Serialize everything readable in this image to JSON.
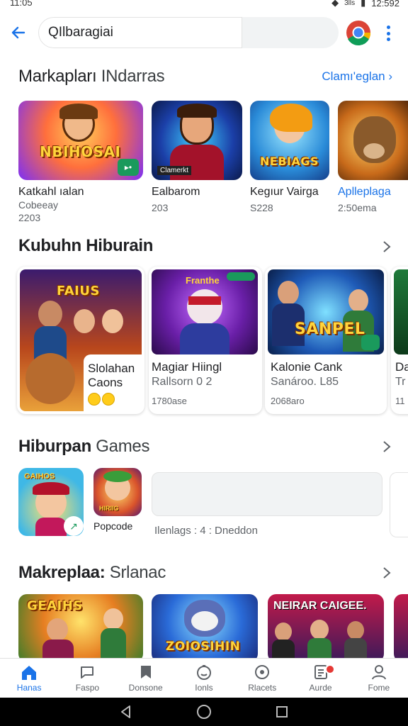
{
  "status": {
    "time": "11:05",
    "right_text": "12:592",
    "sim": "3lls"
  },
  "search": {
    "value": "Q​Ilbaragiai",
    "placeholder": ""
  },
  "sections": {
    "s1": {
      "title_bold": "Markapları",
      "title_rest": " INdarras",
      "link": "Clamı'eglan"
    },
    "s2": {
      "title_bold": "Kubuhn Hiburain"
    },
    "s3": {
      "title_bold": "Hiburpan",
      "title_rest": " Games"
    },
    "s4": {
      "title_bold": "Makreplaa:",
      "title_rest": " Srlanac"
    }
  },
  "row1": [
    {
      "art_text": "NBIHOSAI",
      "name": "Katkahl ıalan",
      "meta1": "Cobeeay",
      "meta2": "2203"
    },
    {
      "art_text": "Clamerkt",
      "name": "Ealbarom",
      "meta1": "203",
      "meta2": ""
    },
    {
      "art_text": "NEBIAGS",
      "name": "Kegıur Vairga",
      "meta1": "S228",
      "meta2": ""
    },
    {
      "art_text": "",
      "name": "Aplleplaga",
      "meta1": "2:50ema",
      "meta2": ""
    }
  ],
  "row2": [
    {
      "art_text": "FAIUS",
      "title": "Slolahan",
      "sub": "Caons",
      "meta": ""
    },
    {
      "art_text": "Franthe",
      "title": "Magiar Hiingl",
      "sub": "Rallsorn 0 2",
      "meta": "1780ase"
    },
    {
      "art_text": "SANPEL",
      "title": "Kalonie Cank",
      "sub": "Sanároo. L85",
      "meta": "2068aro"
    },
    {
      "art_text": "",
      "title": "Da",
      "sub": "Tr",
      "meta": "11"
    }
  ],
  "row3": {
    "tile1_text": "GAIHOS",
    "tile2_text": "HIRIIG",
    "tile2_label": "Popcode",
    "banner_text": "Ilenlags : 4 : Dneddon"
  },
  "row4": [
    {
      "art_text": "GEAIHS"
    },
    {
      "art_text": "ZOIOSIHIN"
    },
    {
      "art_text": "NEIRAR CAIGEE."
    }
  ],
  "nav": [
    {
      "label": "Hanas",
      "icon": "home-icon",
      "active": true
    },
    {
      "label": "Faspo",
      "icon": "chat-icon"
    },
    {
      "label": "Donsone",
      "icon": "bookmark-icon"
    },
    {
      "label": "Ionls",
      "icon": "face-icon"
    },
    {
      "label": "Rlacets",
      "icon": "badge-icon"
    },
    {
      "label": "Aurde",
      "icon": "notes-icon",
      "badge": true
    },
    {
      "label": "Fome",
      "icon": "profile-icon"
    }
  ],
  "colors": {
    "accent": "#1a73e8",
    "text": "#202124",
    "muted": "#5f6368",
    "badge": "#e53935"
  }
}
